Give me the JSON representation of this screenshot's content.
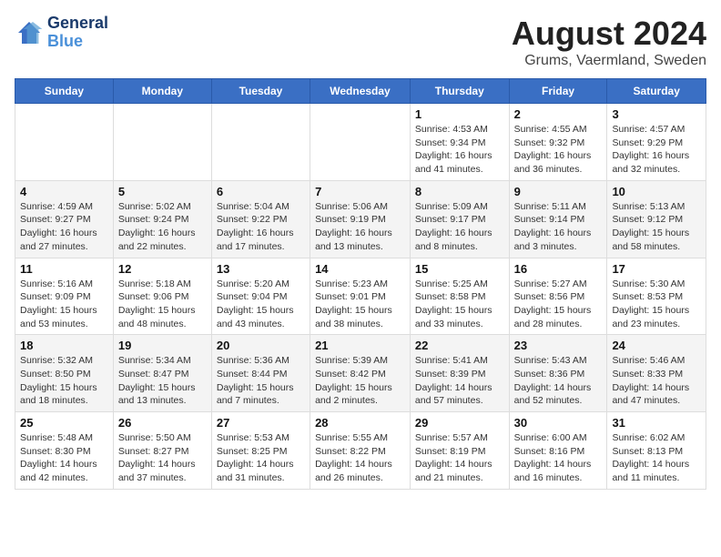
{
  "logo": {
    "line1": "General",
    "line2": "Blue"
  },
  "title": "August 2024",
  "subtitle": "Grums, Vaermland, Sweden",
  "days_of_week": [
    "Sunday",
    "Monday",
    "Tuesday",
    "Wednesday",
    "Thursday",
    "Friday",
    "Saturday"
  ],
  "weeks": [
    [
      {
        "day": "",
        "info": ""
      },
      {
        "day": "",
        "info": ""
      },
      {
        "day": "",
        "info": ""
      },
      {
        "day": "",
        "info": ""
      },
      {
        "day": "1",
        "info": "Sunrise: 4:53 AM\nSunset: 9:34 PM\nDaylight: 16 hours\nand 41 minutes."
      },
      {
        "day": "2",
        "info": "Sunrise: 4:55 AM\nSunset: 9:32 PM\nDaylight: 16 hours\nand 36 minutes."
      },
      {
        "day": "3",
        "info": "Sunrise: 4:57 AM\nSunset: 9:29 PM\nDaylight: 16 hours\nand 32 minutes."
      }
    ],
    [
      {
        "day": "4",
        "info": "Sunrise: 4:59 AM\nSunset: 9:27 PM\nDaylight: 16 hours\nand 27 minutes."
      },
      {
        "day": "5",
        "info": "Sunrise: 5:02 AM\nSunset: 9:24 PM\nDaylight: 16 hours\nand 22 minutes."
      },
      {
        "day": "6",
        "info": "Sunrise: 5:04 AM\nSunset: 9:22 PM\nDaylight: 16 hours\nand 17 minutes."
      },
      {
        "day": "7",
        "info": "Sunrise: 5:06 AM\nSunset: 9:19 PM\nDaylight: 16 hours\nand 13 minutes."
      },
      {
        "day": "8",
        "info": "Sunrise: 5:09 AM\nSunset: 9:17 PM\nDaylight: 16 hours\nand 8 minutes."
      },
      {
        "day": "9",
        "info": "Sunrise: 5:11 AM\nSunset: 9:14 PM\nDaylight: 16 hours\nand 3 minutes."
      },
      {
        "day": "10",
        "info": "Sunrise: 5:13 AM\nSunset: 9:12 PM\nDaylight: 15 hours\nand 58 minutes."
      }
    ],
    [
      {
        "day": "11",
        "info": "Sunrise: 5:16 AM\nSunset: 9:09 PM\nDaylight: 15 hours\nand 53 minutes."
      },
      {
        "day": "12",
        "info": "Sunrise: 5:18 AM\nSunset: 9:06 PM\nDaylight: 15 hours\nand 48 minutes."
      },
      {
        "day": "13",
        "info": "Sunrise: 5:20 AM\nSunset: 9:04 PM\nDaylight: 15 hours\nand 43 minutes."
      },
      {
        "day": "14",
        "info": "Sunrise: 5:23 AM\nSunset: 9:01 PM\nDaylight: 15 hours\nand 38 minutes."
      },
      {
        "day": "15",
        "info": "Sunrise: 5:25 AM\nSunset: 8:58 PM\nDaylight: 15 hours\nand 33 minutes."
      },
      {
        "day": "16",
        "info": "Sunrise: 5:27 AM\nSunset: 8:56 PM\nDaylight: 15 hours\nand 28 minutes."
      },
      {
        "day": "17",
        "info": "Sunrise: 5:30 AM\nSunset: 8:53 PM\nDaylight: 15 hours\nand 23 minutes."
      }
    ],
    [
      {
        "day": "18",
        "info": "Sunrise: 5:32 AM\nSunset: 8:50 PM\nDaylight: 15 hours\nand 18 minutes."
      },
      {
        "day": "19",
        "info": "Sunrise: 5:34 AM\nSunset: 8:47 PM\nDaylight: 15 hours\nand 13 minutes."
      },
      {
        "day": "20",
        "info": "Sunrise: 5:36 AM\nSunset: 8:44 PM\nDaylight: 15 hours\nand 7 minutes."
      },
      {
        "day": "21",
        "info": "Sunrise: 5:39 AM\nSunset: 8:42 PM\nDaylight: 15 hours\nand 2 minutes."
      },
      {
        "day": "22",
        "info": "Sunrise: 5:41 AM\nSunset: 8:39 PM\nDaylight: 14 hours\nand 57 minutes."
      },
      {
        "day": "23",
        "info": "Sunrise: 5:43 AM\nSunset: 8:36 PM\nDaylight: 14 hours\nand 52 minutes."
      },
      {
        "day": "24",
        "info": "Sunrise: 5:46 AM\nSunset: 8:33 PM\nDaylight: 14 hours\nand 47 minutes."
      }
    ],
    [
      {
        "day": "25",
        "info": "Sunrise: 5:48 AM\nSunset: 8:30 PM\nDaylight: 14 hours\nand 42 minutes."
      },
      {
        "day": "26",
        "info": "Sunrise: 5:50 AM\nSunset: 8:27 PM\nDaylight: 14 hours\nand 37 minutes."
      },
      {
        "day": "27",
        "info": "Sunrise: 5:53 AM\nSunset: 8:25 PM\nDaylight: 14 hours\nand 31 minutes."
      },
      {
        "day": "28",
        "info": "Sunrise: 5:55 AM\nSunset: 8:22 PM\nDaylight: 14 hours\nand 26 minutes."
      },
      {
        "day": "29",
        "info": "Sunrise: 5:57 AM\nSunset: 8:19 PM\nDaylight: 14 hours\nand 21 minutes."
      },
      {
        "day": "30",
        "info": "Sunrise: 6:00 AM\nSunset: 8:16 PM\nDaylight: 14 hours\nand 16 minutes."
      },
      {
        "day": "31",
        "info": "Sunrise: 6:02 AM\nSunset: 8:13 PM\nDaylight: 14 hours\nand 11 minutes."
      }
    ]
  ]
}
